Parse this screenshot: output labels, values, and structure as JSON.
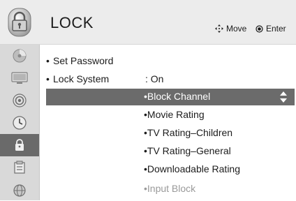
{
  "header": {
    "title": "LOCK",
    "move_label": "Move",
    "enter_label": "Enter"
  },
  "sidebar": {
    "items": [
      {
        "icon": "picture-disc-icon"
      },
      {
        "icon": "monitor-icon"
      },
      {
        "icon": "audio-speaker-icon"
      },
      {
        "icon": "clock-icon"
      },
      {
        "icon": "lock-icon",
        "active": true
      },
      {
        "icon": "options-box-icon"
      },
      {
        "icon": "network-globe-icon"
      }
    ]
  },
  "menu": {
    "set_password": "Set Password",
    "lock_system": "Lock System",
    "lock_system_value": ": On",
    "bullet": "•",
    "sub_items": [
      "Block Channel",
      "Movie Rating",
      "TV Rating–Children",
      "TV Rating–General",
      "Downloadable Rating",
      "Input Block"
    ],
    "selected_index": 0
  },
  "colors": {
    "highlight": "#6b6b6b",
    "sidebar": "#d9d9d9",
    "header": "#ececec"
  }
}
